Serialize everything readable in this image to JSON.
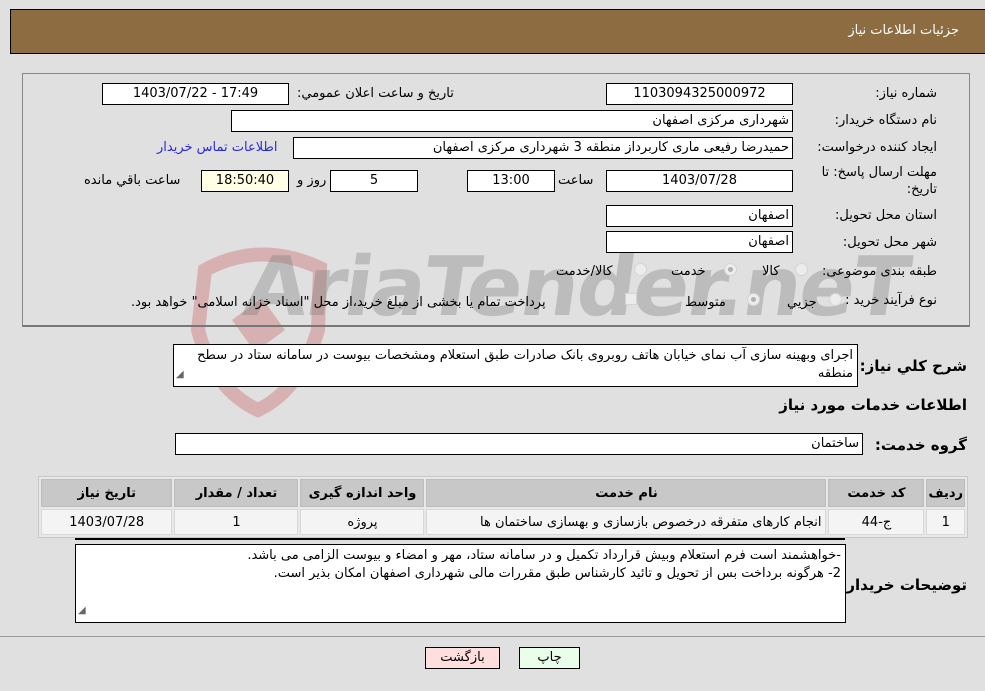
{
  "header": {
    "title": "جزئیات اطلاعات نیاز"
  },
  "form": {
    "need_number": {
      "label": "شماره نیاز:",
      "value": "1103094325000972"
    },
    "announce_datetime": {
      "label": "تاریخ و ساعت اعلان عمومي:",
      "value": "1403/07/22 - 17:49"
    },
    "buyer_org": {
      "label": "نام دستگاه خریدار:",
      "value": "شهرداری مرکزی اصفهان"
    },
    "requester": {
      "label": "ایجاد کننده درخواست:",
      "value": "حمیدرضا رفیعی ماری کاربرداز منطقه 3 شهرداری مرکزی اصفهان"
    },
    "buyer_contact_link": "اطلاعات تماس خریدار",
    "deadline": {
      "label_line1": "مهلت ارسال پاسخ: تا",
      "label_line2": "تاریخ:",
      "date": "1403/07/28",
      "time_label": "ساعت",
      "time": "13:00",
      "days": "5",
      "days_label": "روز و",
      "remaining_time": "18:50:40",
      "remaining_label": "ساعت باقي مانده"
    },
    "delivery_province": {
      "label": "استان محل تحویل:",
      "value": "اصفهان"
    },
    "delivery_city": {
      "label": "شهر محل تحویل:",
      "value": "اصفهان"
    },
    "category": {
      "label": "طبقه بندی موضوعی:",
      "options": [
        "کالا",
        "خدمت",
        "کالا/خدمت"
      ],
      "selected": "خدمت"
    },
    "purchase_type": {
      "label": "نوع فرآیند خرید :",
      "options": [
        "جزيي",
        "متوسط"
      ],
      "selected": "متوسط",
      "treasury_checkbox_label": "پرداخت تمام یا بخشی از مبلغ خرید،از محل \"اسناد خزانه اسلامی\" خواهد بود.",
      "treasury_checked": false
    }
  },
  "description": {
    "label": "شرح کلي نیاز:",
    "value": "اجرای وبهینه سازی آب نمای خیابان هاتف روبروی بانک صادرات طبق استعلام ومشخصات بیوست در سامانه ستاد در سطح منطقه"
  },
  "services_section": {
    "title": "اطلاعات خدمات مورد نیاز",
    "group_label": "گروه خدمت:",
    "group_value": "ساختمان"
  },
  "services_table": {
    "columns": [
      "ردیف",
      "کد خدمت",
      "نام خدمت",
      "واحد اندازه گیری",
      "تعداد / مقدار",
      "تاریخ نیاز"
    ],
    "rows": [
      [
        "1",
        "ج-44",
        "انجام کارهای متفرقه درخصوص بازسازی و بهسازی ساختمان ها",
        "پروژه",
        "1",
        "1403/07/28"
      ]
    ]
  },
  "buyer_notes": {
    "label": "توضیحات خریدار:",
    "line1": "-خواهشمند است فرم استعلام  وبیش قرارداد تکمیل و در سامانه ستاد، مهر و امضاء و بیوست الزامی می باشد.",
    "line2": "2- هرگونه برداخت بس از تحویل و تائید کارشناس طبق مقررات مالی شهرداری اصفهان امکان بذیر است."
  },
  "buttons": {
    "print": "چاپ",
    "back": "بازگشت"
  },
  "watermark": {
    "text": "AriaTender.neT"
  },
  "colors": {
    "header_bg": "#8d6c42",
    "link": "#2a2ad4",
    "print_btn": "#eaffea",
    "back_btn": "#ffdede"
  }
}
